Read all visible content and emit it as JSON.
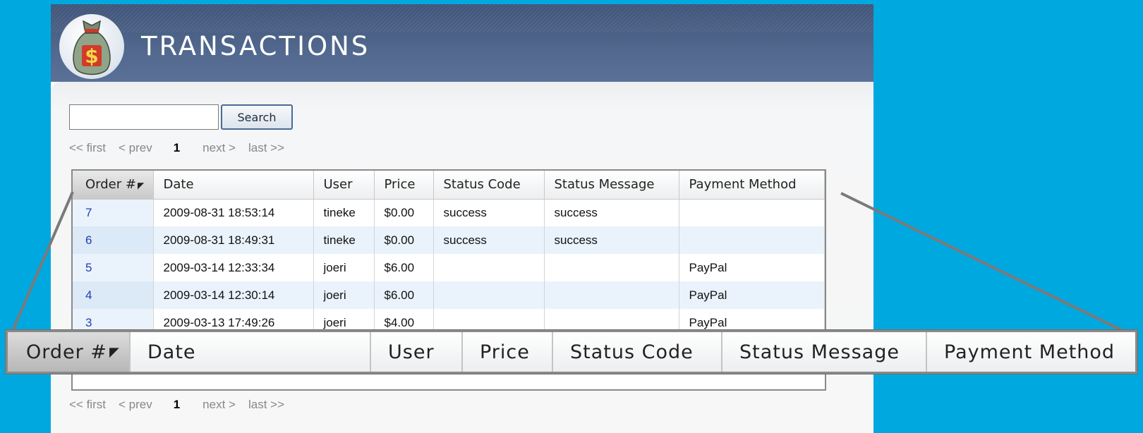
{
  "header": {
    "title": "TRANSACTIONS",
    "logo_icon": "money-bag-icon"
  },
  "search": {
    "value": "",
    "button_label": "Search"
  },
  "pager": {
    "first": "<< first",
    "prev": "< prev",
    "current": "1",
    "next": "next >",
    "last": "last >>"
  },
  "table": {
    "columns": [
      "Order #",
      "Date",
      "User",
      "Price",
      "Status Code",
      "Status Message",
      "Payment Method"
    ],
    "sort_indicator": "◤",
    "rows": [
      [
        "7",
        "2009-08-31 18:53:14",
        "tineke",
        "$0.00",
        "success",
        "success",
        ""
      ],
      [
        "6",
        "2009-08-31 18:49:31",
        "tineke",
        "$0.00",
        "success",
        "success",
        ""
      ],
      [
        "5",
        "2009-03-14 12:33:34",
        "joeri",
        "$6.00",
        "",
        "",
        "PayPal"
      ],
      [
        "4",
        "2009-03-14 12:30:14",
        "joeri",
        "$6.00",
        "",
        "",
        "PayPal"
      ],
      [
        "3",
        "2009-03-13 17:49:26",
        "joeri",
        "$4.00",
        "",
        "",
        "PayPal"
      ]
    ]
  },
  "colors": {
    "background": "#00a8e0",
    "header": "#4a5f84",
    "link": "#1f3fb0",
    "alt_row": "#eaf3fc"
  }
}
